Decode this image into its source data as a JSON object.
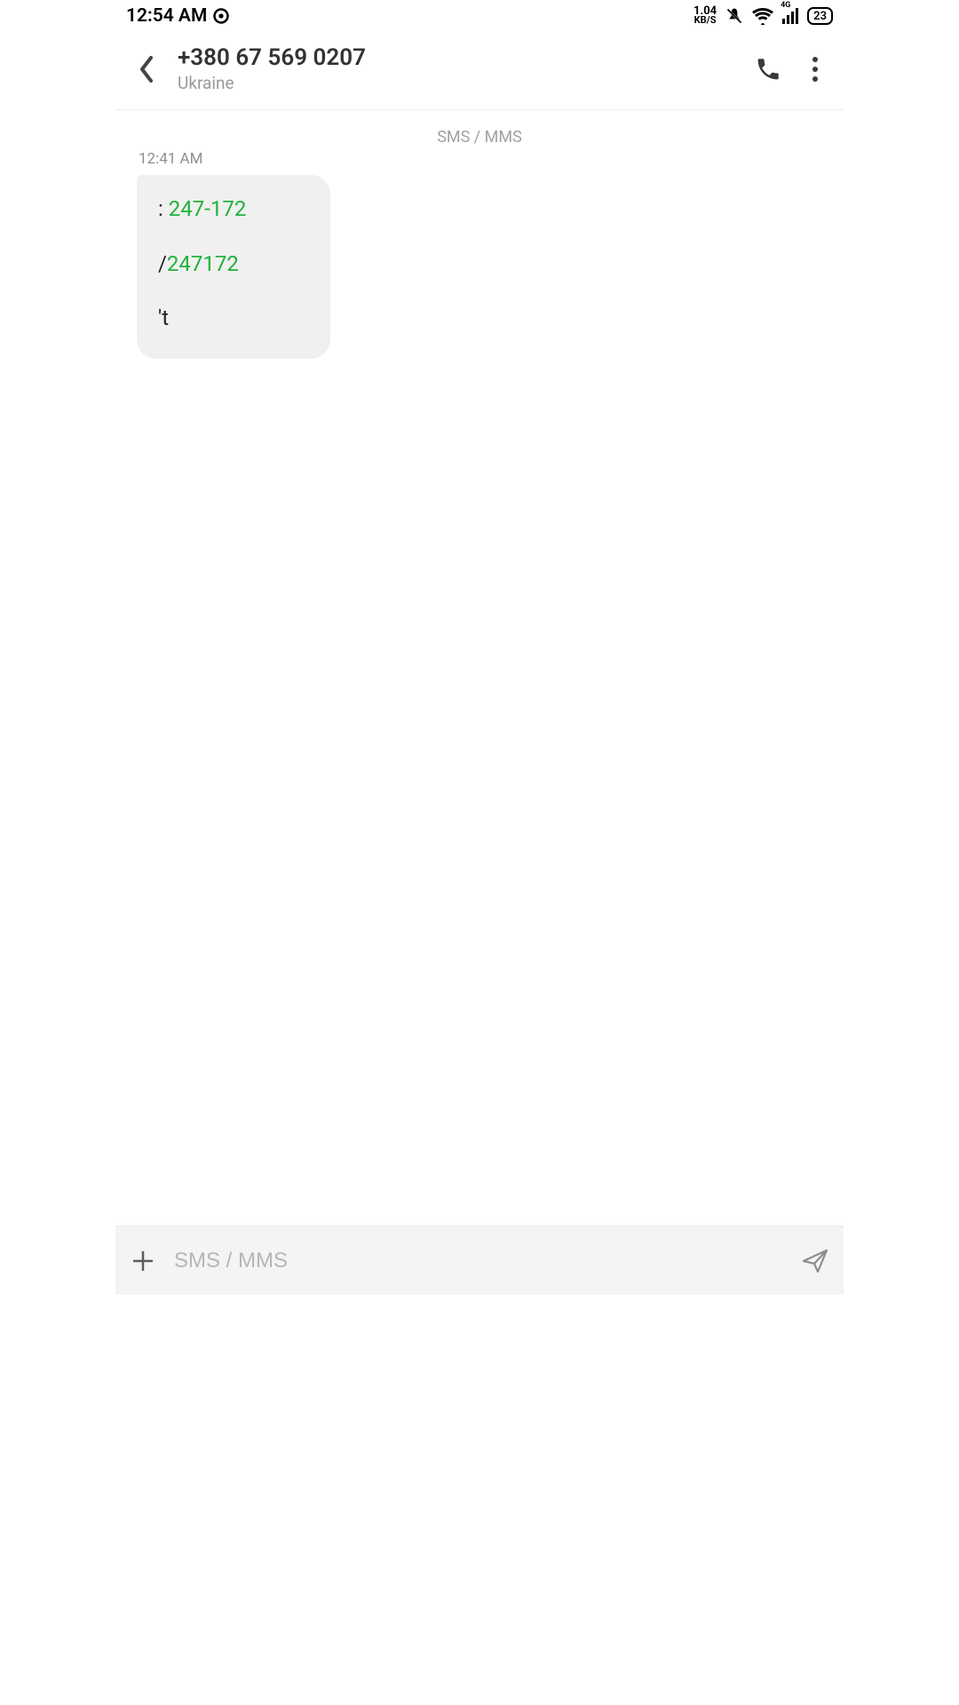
{
  "status": {
    "time": "12:54 AM",
    "kbs_top": "1.04",
    "kbs_bottom": "KB/S",
    "network_label": "4G",
    "battery_pct": "23"
  },
  "header": {
    "title": "+380 67 569 0207",
    "subtitle": "Ukraine"
  },
  "conversation": {
    "channel_label": "SMS / MMS",
    "timestamp": "12:41 AM",
    "message": {
      "line1_prefix": ": ",
      "line1_link": "247-172",
      "line2_prefix": "/",
      "line2_link": "247172",
      "line3": "'t"
    }
  },
  "composer": {
    "placeholder": "SMS / MMS"
  }
}
